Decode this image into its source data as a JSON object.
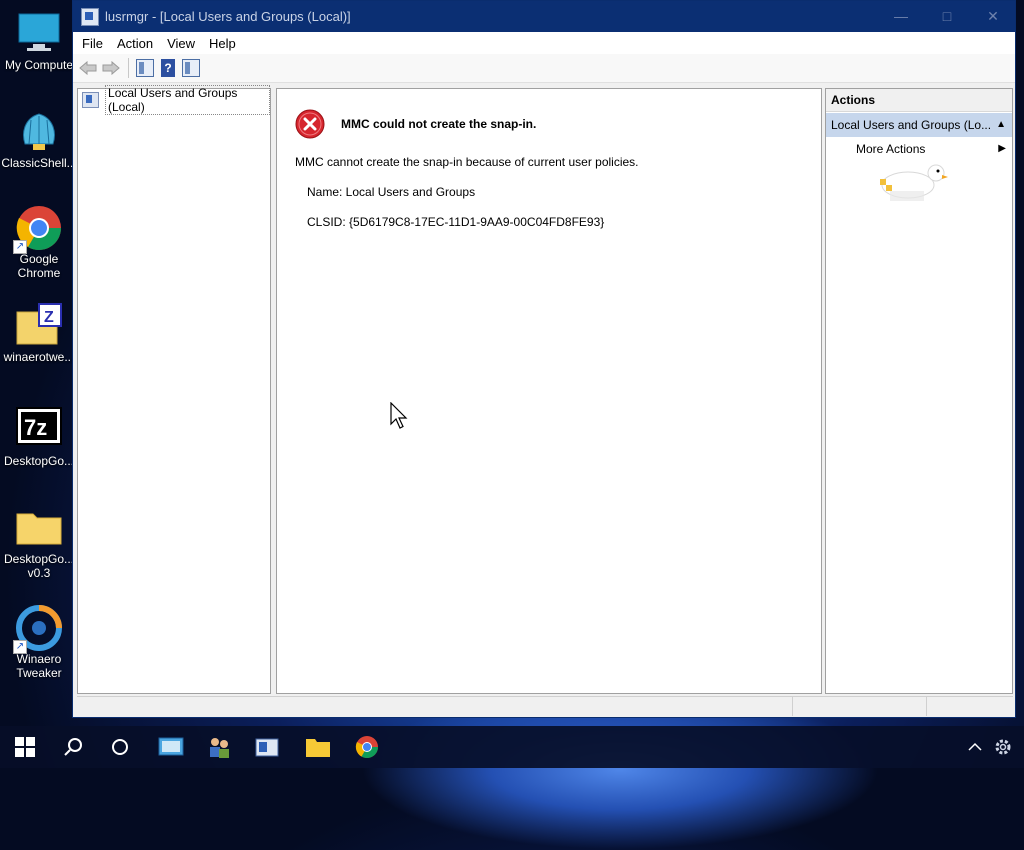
{
  "desktop": {
    "icons": [
      {
        "label": "My Compute",
        "icon": "monitor-icon"
      },
      {
        "label": "ClassicShell...",
        "icon": "shell-icon"
      },
      {
        "label": "Google\nChrome",
        "icon": "chrome-icon"
      },
      {
        "label": "winaerotwe...",
        "icon": "zip-folder-icon"
      },
      {
        "label": "DesktopGo...",
        "icon": "7zip-icon"
      },
      {
        "label": "DesktopGo...\nv0.3",
        "icon": "folder-icon"
      },
      {
        "label": "Winaero\nTweaker",
        "icon": "winaero-icon"
      }
    ]
  },
  "window": {
    "title": "lusrmgr - [Local Users and Groups (Local)]",
    "menu": [
      "File",
      "Action",
      "View",
      "Help"
    ],
    "tree": {
      "root_label": "Local Users and Groups (Local)"
    },
    "error": {
      "title": "MMC could not create the snap-in.",
      "message": "MMC cannot create the snap-in because of current user policies.",
      "name_line": "Name: Local Users and Groups",
      "clsid_line": "CLSID: {5D6179C8-17EC-11D1-9AA9-00C04FD8FE93}"
    },
    "actions": {
      "header": "Actions",
      "section": "Local Users and Groups (Lo...",
      "more": "More Actions"
    }
  },
  "colors": {
    "titlebar": "#0b2f73",
    "actions_section": "#c6d6ec",
    "error_red": "#d6262e"
  }
}
